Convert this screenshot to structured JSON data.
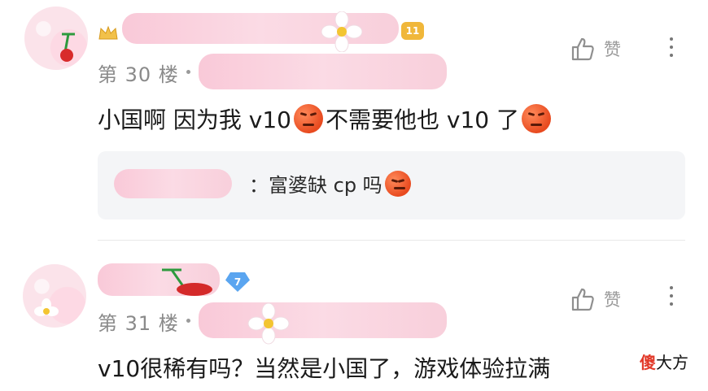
{
  "comments": [
    {
      "floor": "第 30 楼",
      "level": "11",
      "like_label": "赞",
      "content_parts": [
        "小国啊 因为我 v10",
        "不需要他也 v10 了"
      ],
      "reply": {
        "text": "富婆缺 cp 吗"
      }
    },
    {
      "floor": "第 31 楼",
      "level": "7",
      "like_label": "赞",
      "content": "v10很稀有吗？当然是小国了，游戏体验拉满"
    }
  ],
  "watermark": {
    "first": "傻",
    "rest": "大方"
  },
  "colors": {
    "level_gold": "#f0b73a",
    "level_blue": "#5aa5f0",
    "accent": "#e84a1f"
  }
}
